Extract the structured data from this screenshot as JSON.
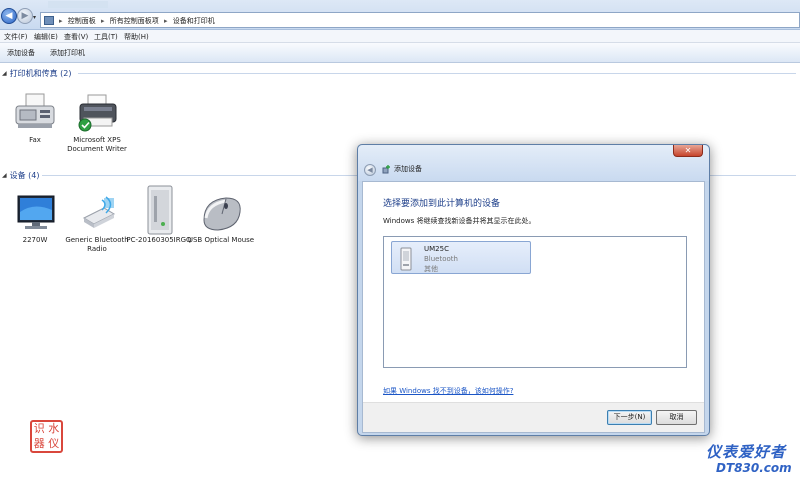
{
  "address": {
    "crumbs": [
      "控制面板",
      "所有控制面板项",
      "设备和打印机"
    ]
  },
  "menu": [
    "文件(F)",
    "编辑(E)",
    "查看(V)",
    "工具(T)",
    "帮助(H)"
  ],
  "commands": [
    "添加设备",
    "添加打印机"
  ],
  "groups": {
    "printers": {
      "title": "打印机和传真 (2)"
    },
    "devices": {
      "title": "设备 (4)"
    }
  },
  "printers": [
    {
      "label": "Fax",
      "icon": "fax-icon"
    },
    {
      "label": "Microsoft XPS Document Writer",
      "icon": "printer-icon",
      "default": true
    }
  ],
  "devices": [
    {
      "label": "2270W",
      "icon": "monitor-icon"
    },
    {
      "label": "Generic Bluetooth Radio",
      "icon": "bluetooth-adapter-icon"
    },
    {
      "label": "PC-20160305IRGQ",
      "icon": "computer-icon"
    },
    {
      "label": "USB Optical Mouse",
      "icon": "mouse-icon"
    }
  ],
  "dialog": {
    "title": "添加设备",
    "heading": "选择要添加到此计算机的设备",
    "subtitle": "Windows 将继续查找新设备并将其显示在此处。",
    "found_device": {
      "name": "UM25C",
      "type": "Bluetooth",
      "category": "其他"
    },
    "help_link": "如果 Windows 找不到设备，该如何操作?",
    "next_button": "下一步(N)",
    "cancel_button": "取消"
  },
  "watermark": {
    "seal_chars": [
      "识",
      "水",
      "器",
      "仪"
    ],
    "brand": "仪表爱好者",
    "url": "DT830.com"
  }
}
